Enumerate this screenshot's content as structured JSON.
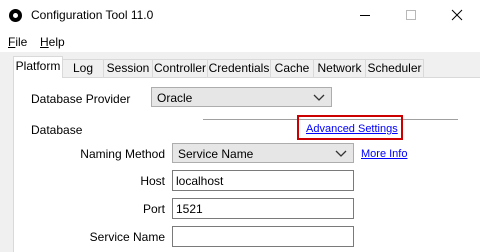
{
  "window": {
    "title": "Configuration Tool 11.0"
  },
  "menu": [
    {
      "label": "File"
    },
    {
      "label": "Help"
    }
  ],
  "tabs": [
    {
      "label": "Platform",
      "active": true
    },
    {
      "label": "Log"
    },
    {
      "label": "Session"
    },
    {
      "label": "Controller"
    },
    {
      "label": "Credentials"
    },
    {
      "label": "Cache"
    },
    {
      "label": "Network"
    },
    {
      "label": "Scheduler"
    }
  ],
  "platform": {
    "database_provider": {
      "label": "Database Provider",
      "value": "Oracle"
    },
    "database_section": {
      "label": "Database",
      "advanced_settings_link": "Advanced Settings",
      "naming_method": {
        "label": "Naming Method",
        "value": "Service Name",
        "more_info_link": "More Info"
      },
      "host": {
        "label": "Host",
        "value": "localhost"
      },
      "port": {
        "label": "Port",
        "value": "1521"
      },
      "service_name": {
        "label": "Service Name",
        "value": ""
      }
    }
  },
  "colors": {
    "highlight": "#cc0000",
    "link": "#0000ff"
  }
}
